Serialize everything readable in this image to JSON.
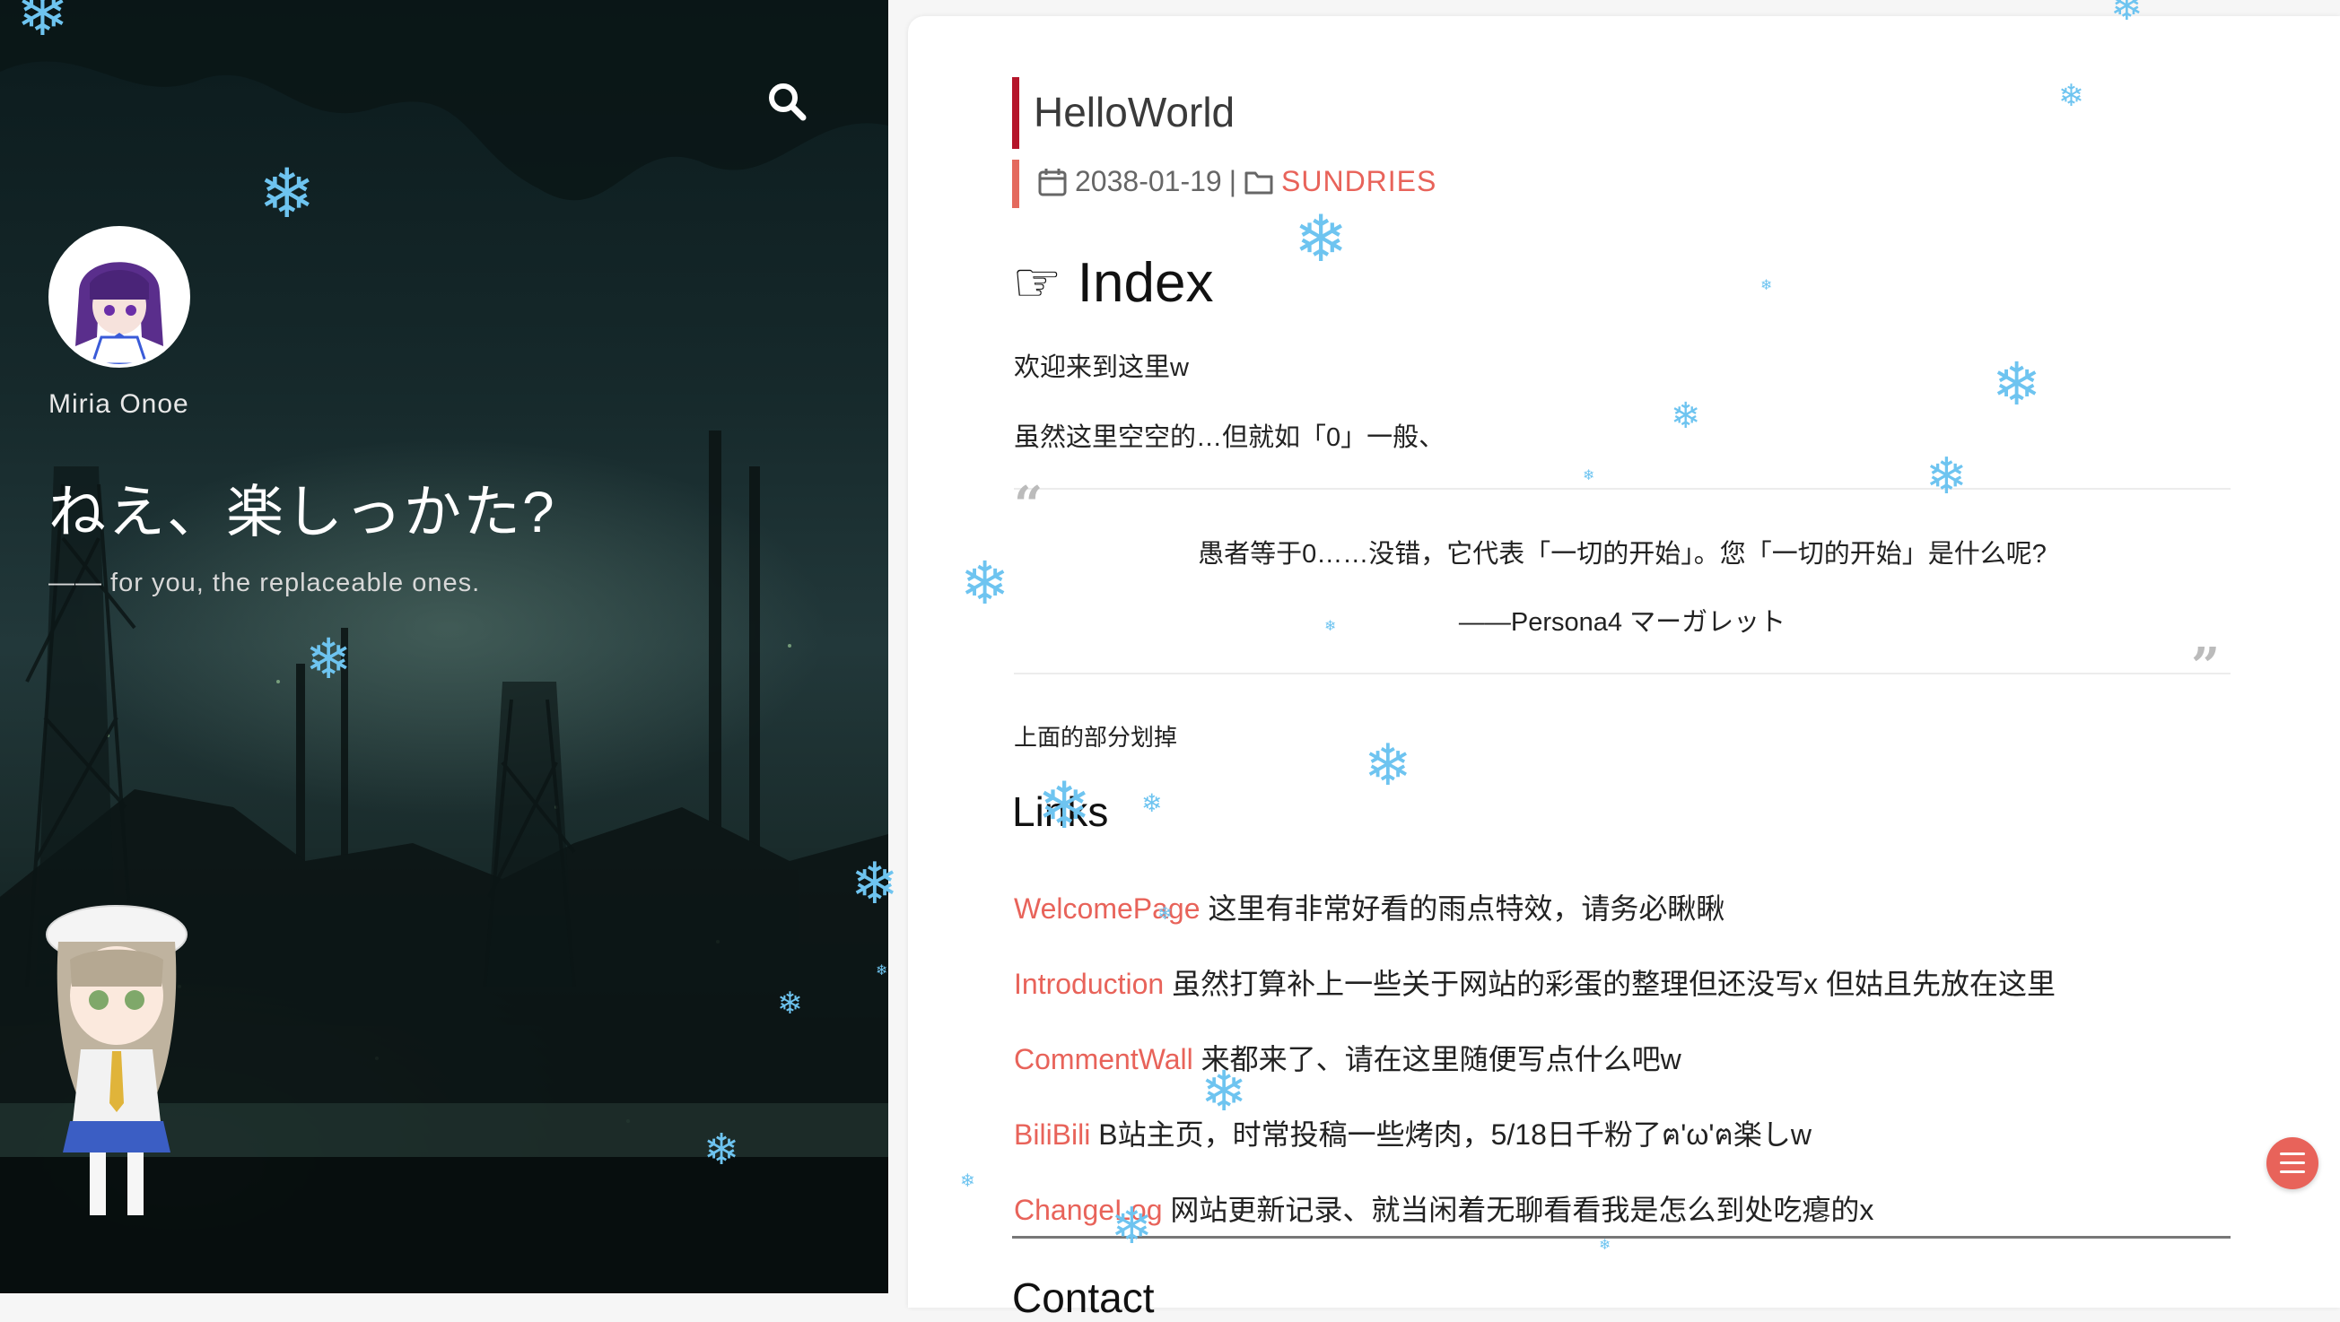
{
  "sidebar": {
    "author": "Miria Onoe",
    "tagline": "ねえ、楽しっかた?",
    "subtitle": "—— for you, the replaceable ones.",
    "search_icon": "search-icon"
  },
  "post": {
    "title": "HelloWorld",
    "date": "2038-01-19",
    "separator": "|",
    "category": "SUNDRIES",
    "index_heading": "☞ Index",
    "welcome": "欢迎来到这里w",
    "intro": "虽然这里空空的…但就如「0」一般、",
    "quote_line1": "愚者等于0……没错，它代表「一切的开始」。您「一切的开始」是什么呢?",
    "quote_line2": "——Persona4 マーガレット",
    "note": "上面的部分划掉",
    "links_heading": "Links",
    "links": [
      {
        "name": "WelcomePage",
        "desc": "这里有非常好看的雨点特效，请务必瞅瞅"
      },
      {
        "name": "Introduction",
        "desc": "虽然打算补上一些关于网站的彩蛋的整理但还没写x 但姑且先放在这里"
      },
      {
        "name": "CommentWall",
        "desc": "来都来了、请在这里随便写点什么吧w"
      },
      {
        "name": "BiliBili",
        "desc": "B站主页，时常投稿一些烤肉，5/18日千粉了ฅ'ω'ฅ楽しw"
      },
      {
        "name": "ChangeLog",
        "desc": "网站更新记录、就当闲着无聊看看我是怎么到处吃瘪的x"
      }
    ],
    "contact_heading": "Contact"
  },
  "colors": {
    "accent": "#e8635a",
    "title_bar": "#b5162b",
    "snow": "#6ec4f0"
  }
}
